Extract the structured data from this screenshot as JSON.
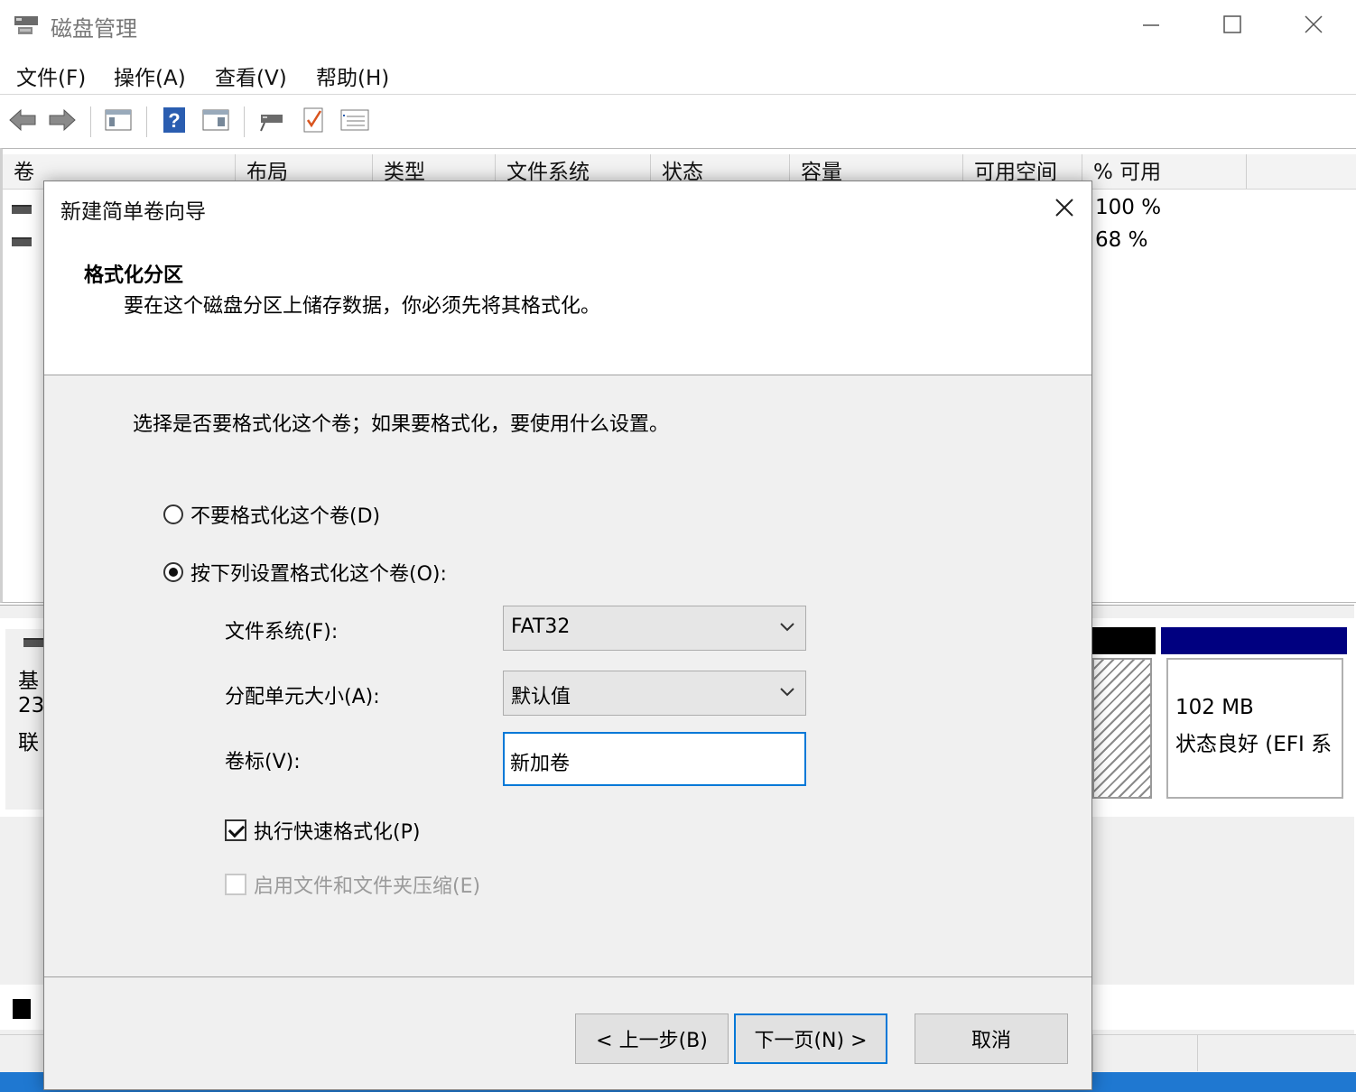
{
  "window": {
    "title": "磁盘管理",
    "controls": [
      "minimize",
      "maximize",
      "close"
    ]
  },
  "menu": [
    "文件(F)",
    "操作(A)",
    "查看(V)",
    "帮助(H)"
  ],
  "toolbar_icons": [
    "back-arrow-icon",
    "forward-arrow-icon",
    "console-tree-icon",
    "help-icon",
    "properties-view-icon",
    "connect-drive-icon",
    "checklist-icon",
    "settings-list-icon"
  ],
  "volume_table": {
    "columns": [
      "卷",
      "布局",
      "类型",
      "文件系统",
      "状态",
      "容量",
      "可用空间",
      "% 可用"
    ],
    "rows": [
      {
        "pct_free": "100 %"
      },
      {
        "pct_free": "68 %"
      }
    ]
  },
  "disk_view": {
    "label_lines": [
      "基",
      "23",
      "联"
    ],
    "efi_partition": {
      "size": "102 MB",
      "status": "状态良好 (EFI 系"
    }
  },
  "wizard": {
    "title": "新建简单卷向导",
    "heading": "格式化分区",
    "subheading": "要在这个磁盘分区上储存数据，你必须先将其格式化。",
    "instruction": "选择是否要格式化这个卷；如果要格式化，要使用什么设置。",
    "option_no_format": "不要格式化这个卷(D)",
    "option_format": "按下列设置格式化这个卷(O):",
    "selected_option": "format",
    "filesystem_label": "文件系统(F):",
    "filesystem_value": "FAT32",
    "alloc_label": "分配单元大小(A):",
    "alloc_value": "默认值",
    "volume_label_label": "卷标(V):",
    "volume_label_value": "新加卷",
    "quick_format_label": "执行快速格式化(P)",
    "quick_format_checked": true,
    "compression_label": "启用文件和文件夹压缩(E)",
    "compression_enabled": false,
    "back_button": "< 上一步(B)",
    "next_button": "下一页(N) >",
    "cancel_button": "取消"
  }
}
